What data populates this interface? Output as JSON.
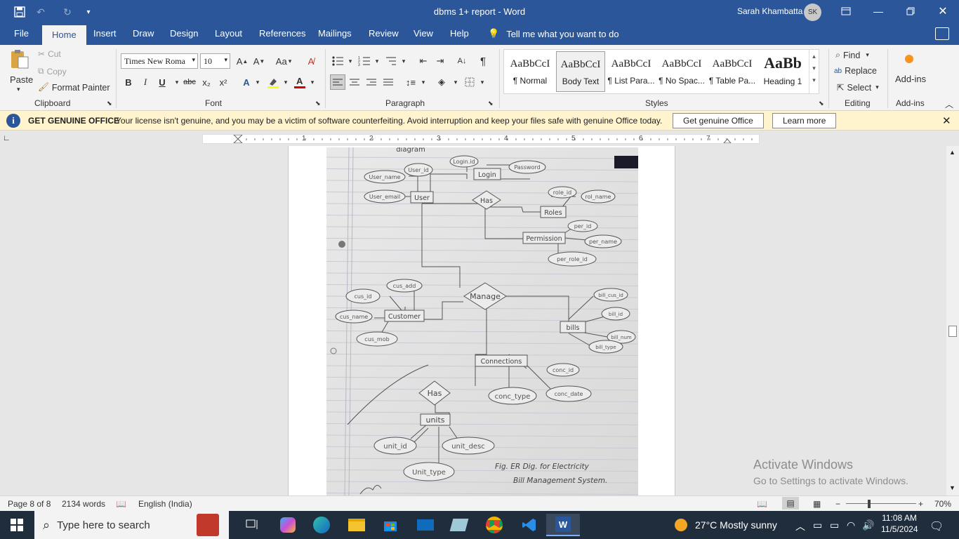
{
  "titlebar": {
    "doc_title": "dbms 1+ report  -  Word",
    "user_name": "Sarah Khambatta",
    "user_initials": "SK"
  },
  "tabs": [
    "File",
    "Home",
    "Insert",
    "Draw",
    "Design",
    "Layout",
    "References",
    "Mailings",
    "Review",
    "View",
    "Help"
  ],
  "active_tab": "Home",
  "tell_me": "Tell me what you want to do",
  "clipboard": {
    "paste": "Paste",
    "cut": "Cut",
    "copy": "Copy",
    "format_painter": "Format Painter",
    "label": "Clipboard"
  },
  "font": {
    "name": "Times New Roma",
    "size": "10",
    "label": "Font",
    "change_case": "Aa",
    "bold": "B",
    "italic": "I",
    "underline": "U",
    "strike": "abc",
    "subscript": "x₂",
    "superscript": "x²"
  },
  "paragraph": {
    "label": "Paragraph"
  },
  "styles": {
    "label": "Styles",
    "items": [
      {
        "sample": "AaBbCcI",
        "name": "¶ Normal"
      },
      {
        "sample": "AaBbCcI",
        "name": "Body Text"
      },
      {
        "sample": "AaBbCcI",
        "name": "¶ List Para..."
      },
      {
        "sample": "AaBbCcI",
        "name": "¶ No Spac..."
      },
      {
        "sample": "AaBbCcI",
        "name": "¶ Table Pa..."
      },
      {
        "sample": "AaBb",
        "name": "Heading 1"
      }
    ],
    "selected_index": 1
  },
  "editing": {
    "find": "Find",
    "replace": "Replace",
    "select": "Select",
    "label": "Editing"
  },
  "addins": {
    "button": "Add-ins",
    "label": "Add-ins"
  },
  "notice": {
    "title": "GET GENUINE OFFICE",
    "message": "Your license isn't genuine, and you may be a victim of software counterfeiting. Avoid interruption and keep your files safe with genuine Office today.",
    "primary_button": "Get genuine Office",
    "secondary_button": "Learn more"
  },
  "ruler": {
    "numbers": [
      "1",
      "2",
      "3",
      "4",
      "5",
      "6",
      "7"
    ]
  },
  "diagram": {
    "heading": "diagram",
    "entities": [
      "Login",
      "User",
      "Roles",
      "Permission",
      "Customer",
      "bills",
      "Connections",
      "units"
    ],
    "relationships": [
      "Has",
      "Manage",
      "Has"
    ],
    "attributes": [
      "Login.id",
      "Password",
      "User_id",
      "User_name",
      "User_email",
      "role_id",
      "rol_name",
      "per_id",
      "per_name",
      "per_role_id",
      "cus_add",
      "cus_id",
      "cus_name",
      "cus_mob",
      "bill_cus_id",
      "bill_id",
      "bill_num",
      "bill_type",
      "conc_id",
      "conc_type",
      "conc_date",
      "unit_id",
      "unit_desc",
      "Unit_type"
    ],
    "caption_line1": "Fig. ER Dig. for Electricity",
    "caption_line2": "Bill Management System."
  },
  "watermark": {
    "line1": "Activate Windows",
    "line2": "Go to Settings to activate Windows."
  },
  "status": {
    "page": "Page 8 of 8",
    "words": "2134 words",
    "language": "English (India)",
    "zoom": "70%"
  },
  "taskbar": {
    "search_placeholder": "Type here to search",
    "weather": "27°C  Mostly sunny",
    "time": "11:08 AM",
    "date": "11/5/2024"
  }
}
